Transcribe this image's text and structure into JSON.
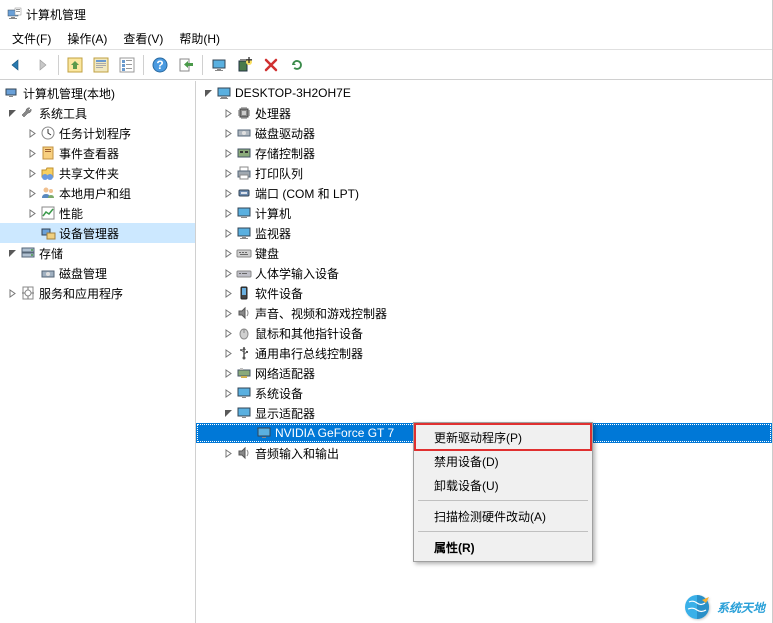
{
  "window": {
    "title": "计算机管理"
  },
  "menubar": {
    "items": [
      {
        "label": "文件(F)"
      },
      {
        "label": "操作(A)"
      },
      {
        "label": "查看(V)"
      },
      {
        "label": "帮助(H)"
      }
    ]
  },
  "toolbar": {
    "icons": {
      "back": "back-arrow-icon",
      "forward": "forward-arrow-icon",
      "up": "up-arrow-boxed-icon",
      "properties": "properties-icon",
      "list": "list-icon",
      "help": "help-icon",
      "export": "export-icon",
      "monitor": "monitor-icon",
      "device_add": "device-add-icon",
      "delete": "delete-x-icon",
      "refresh": "refresh-icon"
    }
  },
  "left_tree": {
    "root": {
      "label": "计算机管理(本地)"
    },
    "system_tools": {
      "label": "系统工具"
    },
    "task_scheduler": {
      "label": "任务计划程序"
    },
    "event_viewer": {
      "label": "事件查看器"
    },
    "shared_folders": {
      "label": "共享文件夹"
    },
    "local_users": {
      "label": "本地用户和组"
    },
    "performance": {
      "label": "性能"
    },
    "device_manager": {
      "label": "设备管理器"
    },
    "storage": {
      "label": "存储"
    },
    "disk_mgmt": {
      "label": "磁盘管理"
    },
    "services_apps": {
      "label": "服务和应用程序"
    }
  },
  "right_tree": {
    "root": {
      "label": "DESKTOP-3H2OH7E"
    },
    "processor": {
      "label": "处理器"
    },
    "disk_drives": {
      "label": "磁盘驱动器"
    },
    "storage_ctrl": {
      "label": "存储控制器"
    },
    "print_queues": {
      "label": "打印队列"
    },
    "ports": {
      "label": "端口 (COM 和 LPT)"
    },
    "computer": {
      "label": "计算机"
    },
    "monitors": {
      "label": "监视器"
    },
    "keyboards": {
      "label": "键盘"
    },
    "hid": {
      "label": "人体学输入设备"
    },
    "software_dev": {
      "label": "软件设备"
    },
    "sound": {
      "label": "声音、视频和游戏控制器"
    },
    "mice": {
      "label": "鼠标和其他指针设备"
    },
    "usb_ctrl": {
      "label": "通用串行总线控制器"
    },
    "network": {
      "label": "网络适配器"
    },
    "system_dev": {
      "label": "系统设备"
    },
    "display": {
      "label": "显示适配器"
    },
    "gpu": {
      "label": "NVIDIA GeForce GT 7"
    },
    "audio_io": {
      "label": "音频输入和输出"
    }
  },
  "context_menu": {
    "update_driver": "更新驱动程序(P)",
    "disable_device": "禁用设备(D)",
    "uninstall_device": "卸载设备(U)",
    "scan_hardware": "扫描检测硬件改动(A)",
    "properties": "属性(R)"
  },
  "watermark": {
    "text": "系统天地"
  }
}
